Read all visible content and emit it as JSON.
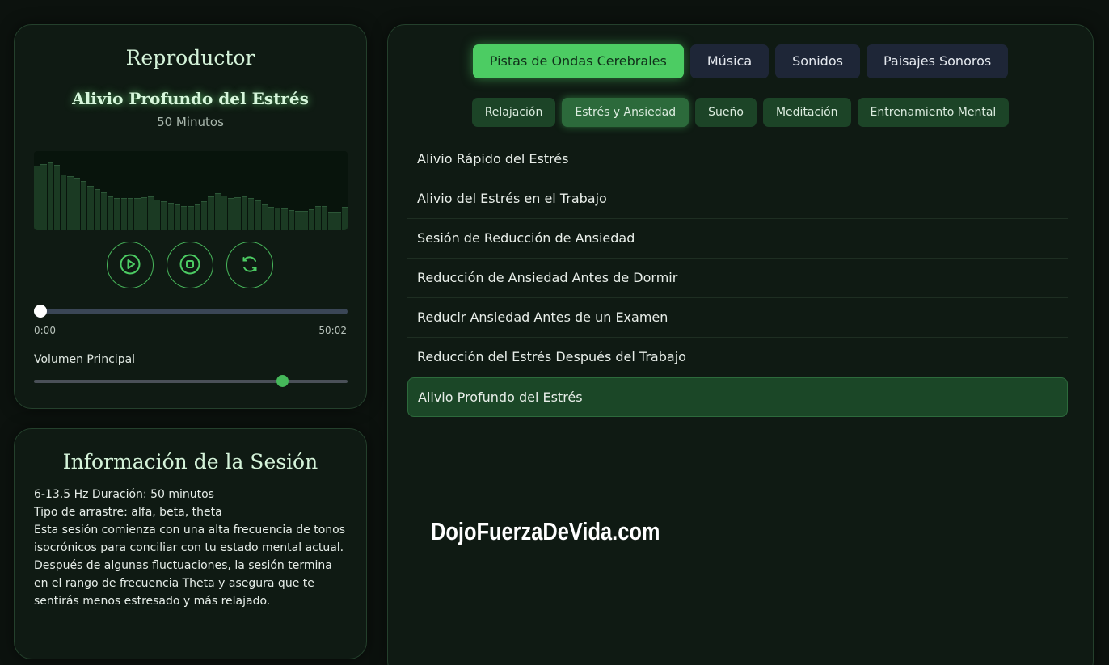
{
  "colors": {
    "accent": "#4ccc63",
    "panel_bg": "#0f1a13",
    "page_bg": "#0c120e"
  },
  "player": {
    "title": "Reproductor",
    "track_title": "Alivio Profundo del Estrés",
    "track_duration": "50 Minutos",
    "visualizer_levels": [
      0.82,
      0.84,
      0.86,
      0.83,
      0.7,
      0.68,
      0.66,
      0.62,
      0.56,
      0.52,
      0.48,
      0.43,
      0.41,
      0.41,
      0.41,
      0.41,
      0.42,
      0.43,
      0.39,
      0.37,
      0.35,
      0.33,
      0.31,
      0.31,
      0.33,
      0.37,
      0.43,
      0.47,
      0.44,
      0.41,
      0.42,
      0.43,
      0.41,
      0.38,
      0.33,
      0.3,
      0.29,
      0.28,
      0.26,
      0.24,
      0.24,
      0.27,
      0.31,
      0.31,
      0.23,
      0.23,
      0.3
    ],
    "controls": {
      "play_icon": "play-icon",
      "stop_icon": "stop-icon",
      "loop_icon": "loop-icon"
    },
    "progress_fraction": 0.02,
    "time_current": "0:00",
    "time_total": "50:02",
    "volume_label": "Volumen Principal",
    "volume_fraction": 0.79
  },
  "session": {
    "title": "Información de la Sesión",
    "lines": [
      "6-13.5 Hz Duración: 50 minutos",
      "Tipo de arrastre: alfa, beta, theta",
      "Esta sesión comienza con una alta frecuencia de tonos isocrónicos para conciliar con tu estado mental actual. Después de algunas fluctuaciones, la sesión termina en el rango de frecuencia Theta y asegura que te sentirás menos estresado y más relajado."
    ]
  },
  "library": {
    "categories": [
      {
        "label": "Pistas de Ondas Cerebrales",
        "active": true
      },
      {
        "label": "Música",
        "active": false
      },
      {
        "label": "Sonidos",
        "active": false
      },
      {
        "label": "Paisajes Sonoros",
        "active": false
      }
    ],
    "subcategories": [
      {
        "label": "Relajación",
        "active": false
      },
      {
        "label": "Estrés y Ansiedad",
        "active": true
      },
      {
        "label": "Sueño",
        "active": false
      },
      {
        "label": "Meditación",
        "active": false
      },
      {
        "label": "Entrenamiento Mental",
        "active": false
      }
    ],
    "tracks": [
      {
        "label": "Alivio Rápido del Estrés",
        "active": false
      },
      {
        "label": "Alivio del Estrés en el Trabajo",
        "active": false
      },
      {
        "label": "Sesión de Reducción de Ansiedad",
        "active": false
      },
      {
        "label": "Reducción de Ansiedad Antes de Dormir",
        "active": false
      },
      {
        "label": "Reducir Ansiedad Antes de un Examen",
        "active": false
      },
      {
        "label": "Reducción del Estrés Después del Trabajo",
        "active": false
      },
      {
        "label": "Alivio Profundo del Estrés",
        "active": true
      }
    ]
  },
  "watermark": "DojoFuerzaDeVida.com"
}
